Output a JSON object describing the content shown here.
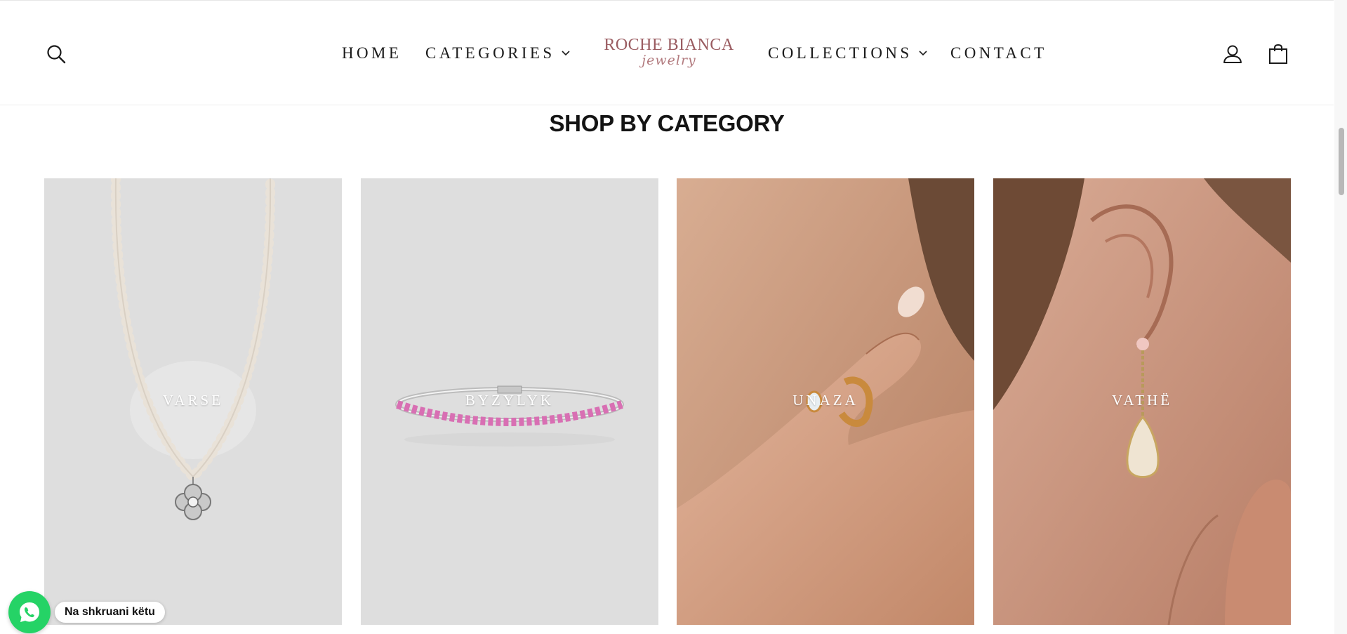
{
  "header": {
    "nav": {
      "home": "HOME",
      "categories": "CATEGORIES",
      "collections": "COLLECTIONS",
      "contact": "CONTACT"
    },
    "logo": {
      "name": "ROCHE BIANCA",
      "tagline": "jewelry"
    },
    "icons": {
      "search": "search-icon",
      "account": "account-icon",
      "cart": "shopping-bag-icon"
    }
  },
  "section": {
    "title": "SHOP BY CATEGORY"
  },
  "categories": [
    {
      "label": "VARSE"
    },
    {
      "label": "BYZYLYK"
    },
    {
      "label": "UNAZA"
    },
    {
      "label": "VATHË"
    }
  ],
  "whatsapp": {
    "text": "Na shkruani këtu",
    "icon": "whatsapp-icon"
  },
  "colors": {
    "brand": "#9a5c61",
    "card_bg": "#dedede",
    "whatsapp": "#25d366"
  }
}
